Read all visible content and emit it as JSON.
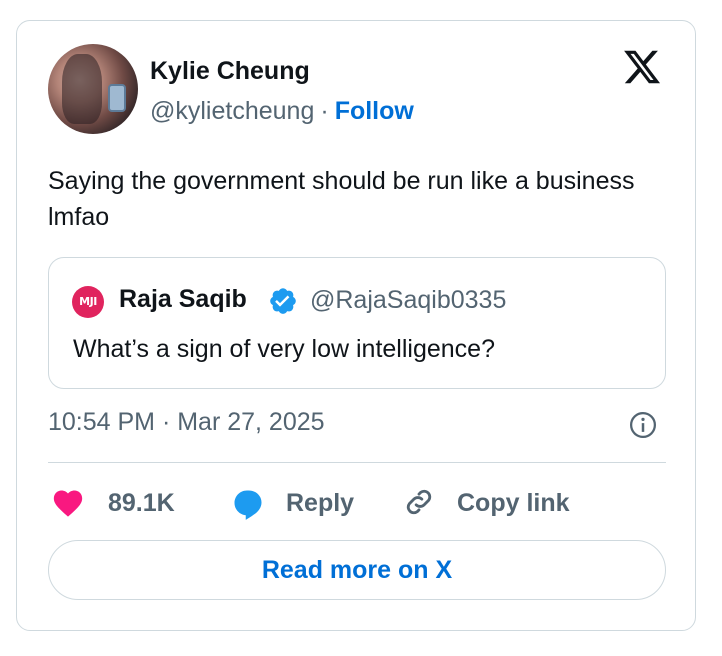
{
  "author": {
    "name": "Kylie Cheung",
    "handle": "@kylietcheung",
    "separator": "·",
    "follow_label": "Follow"
  },
  "tweet": {
    "text": "Saying the government should be run like a business lmfao",
    "timestamp": "10:54 PM · Mar 27, 2025"
  },
  "quoted_tweet": {
    "avatar_text": "MJI",
    "name": "Raja Saqib",
    "handle": "@RajaSaqib0335",
    "text": "What’s a sign of very low intelligence?",
    "verified": true
  },
  "actions": {
    "likes_count": "89.1K",
    "reply_label": "Reply",
    "copy_link_label": "Copy link"
  },
  "read_more_label": "Read more on X",
  "colors": {
    "link_blue": "#006fd6",
    "like_pink": "#f91880",
    "verified_blue": "#1d9bf0",
    "secondary_text": "#536471",
    "border": "#cfd9de"
  },
  "icons": [
    "x-logo-icon",
    "verified-badge-icon",
    "info-icon",
    "heart-icon",
    "reply-bubble-icon",
    "link-icon"
  ]
}
